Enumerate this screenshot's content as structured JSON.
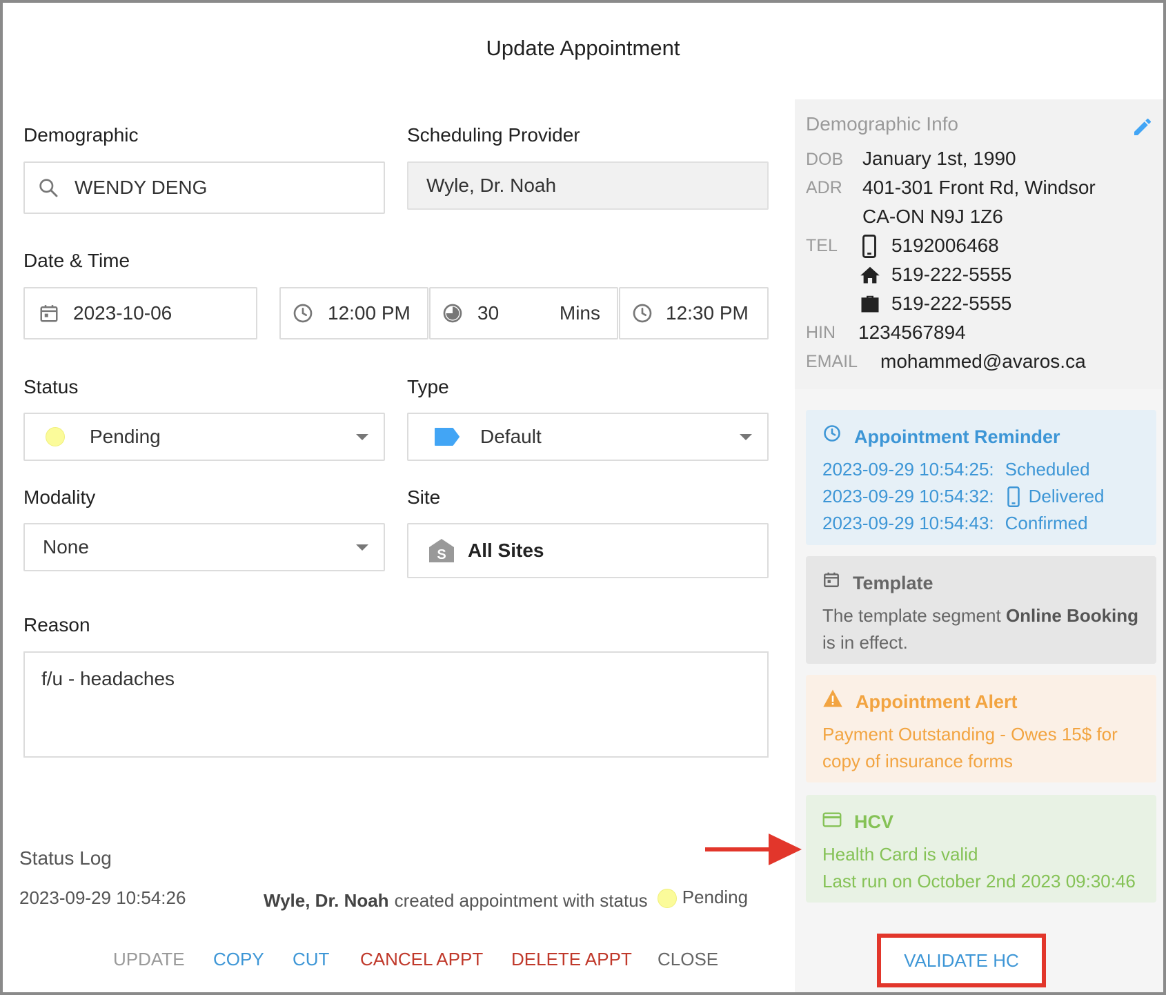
{
  "dialog": {
    "title": "Update Appointment"
  },
  "demographic": {
    "label": "Demographic",
    "value": "WENDY DENG",
    "icon": "search-icon"
  },
  "scheduling_provider": {
    "label": "Scheduling Provider",
    "value": "Wyle, Dr. Noah"
  },
  "date_time": {
    "label": "Date & Time",
    "date": "2023-10-06",
    "start_time": "12:00 PM",
    "duration": "30",
    "duration_unit": "Mins",
    "end_time": "12:30 PM"
  },
  "status": {
    "label": "Status",
    "value": "Pending",
    "color": "#fbfb9a"
  },
  "type": {
    "label": "Type",
    "value": "Default",
    "color": "#42a5f5"
  },
  "modality": {
    "label": "Modality",
    "value": "None"
  },
  "site": {
    "label": "Site",
    "value": "All Sites"
  },
  "reason": {
    "label": "Reason",
    "value": "f/u - headaches"
  },
  "status_log": {
    "title": "Status Log",
    "entries": [
      {
        "time": "2023-09-29 10:54:26",
        "actor": "Wyle, Dr. Noah",
        "text": "created appointment with status",
        "status": "Pending"
      }
    ]
  },
  "actions": {
    "update": "UPDATE",
    "copy": "COPY",
    "cut": "CUT",
    "cancel_appt": "CANCEL APPT",
    "delete_appt": "DELETE APPT",
    "close": "CLOSE",
    "validate_hc": "VALIDATE HC"
  },
  "demographic_info": {
    "title": "Demographic Info",
    "dob_key": "DOB",
    "dob": "January 1st, 1990",
    "adr_key": "ADR",
    "adr_line1": "401-301 Front Rd, Windsor",
    "adr_line2": "CA-ON N9J 1Z6",
    "tel_key": "TEL",
    "tel_mobile": "5192006468",
    "tel_home": "519-222-5555",
    "tel_work": "519-222-5555",
    "hin_key": "HIN",
    "hin": "1234567894",
    "email_key": "EMAIL",
    "email": "mohammed@avaros.ca"
  },
  "reminder": {
    "title": "Appointment Reminder",
    "entries": [
      {
        "time": "2023-09-29 10:54:25:",
        "status": "Scheduled"
      },
      {
        "time": "2023-09-29 10:54:32:",
        "status": "Delivered"
      },
      {
        "time": "2023-09-29 10:54:43:",
        "status": "Confirmed"
      }
    ]
  },
  "template": {
    "title": "Template",
    "text_before": "The template segment",
    "segment": "Online Booking",
    "text_after": "is in effect."
  },
  "alert": {
    "title": "Appointment Alert",
    "text": "Payment Outstanding - Owes 15$ for copy of insurance forms"
  },
  "hcv": {
    "title": "HCV",
    "line1": "Health Card is valid",
    "line2": "Last run on October 2nd 2023 09:30:46"
  },
  "colors": {
    "blue": "#3d96d6",
    "red": "#c0392b",
    "grey": "#9a9a9a",
    "annotation_red": "#e2362b"
  }
}
